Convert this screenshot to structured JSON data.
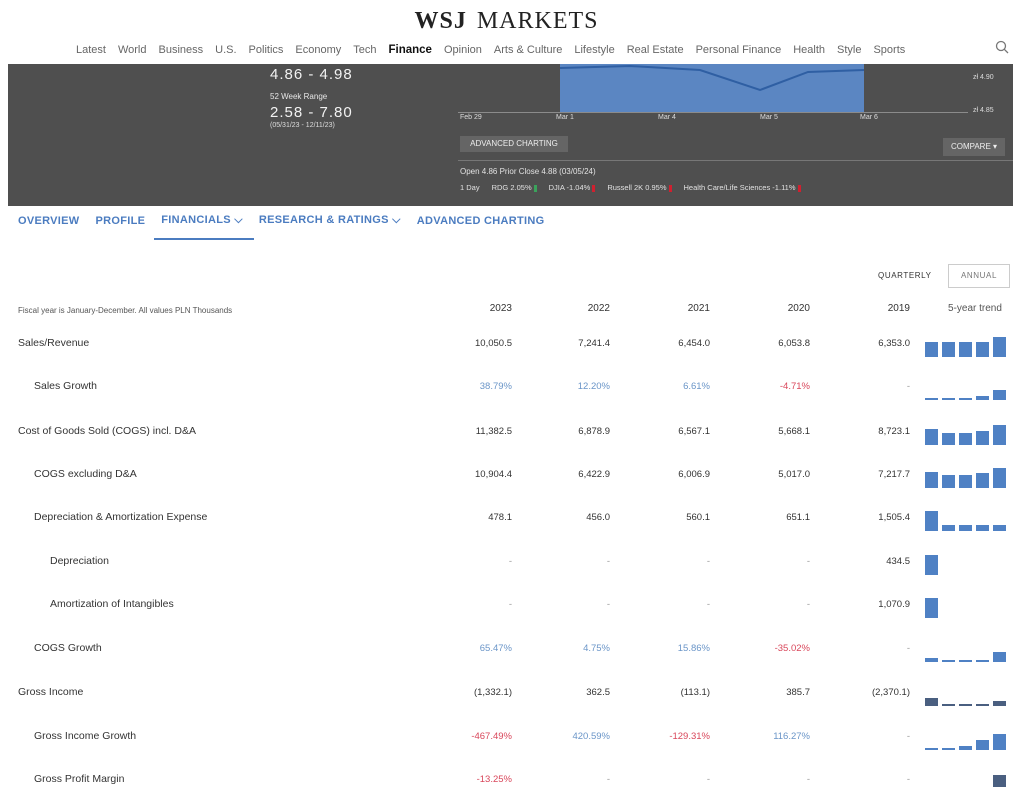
{
  "header": {
    "brand_wsj": "WSJ",
    "brand_markets": "MARKETS",
    "nav": [
      "Latest",
      "World",
      "Business",
      "U.S.",
      "Politics",
      "Economy",
      "Tech",
      "Finance",
      "Opinion",
      "Arts & Culture",
      "Lifestyle",
      "Real Estate",
      "Personal Finance",
      "Health",
      "Style",
      "Sports"
    ],
    "active_nav": "Finance"
  },
  "quote": {
    "day_range": "4.86 - 4.98",
    "week52_label": "52 Week Range",
    "week52_range": "2.58 - 7.80",
    "week52_dates": "(05/31/23 - 12/11/23)",
    "x_ticks": [
      "Feb 29",
      "Mar 1",
      "Mar 4",
      "Mar 5",
      "Mar 6"
    ],
    "y_ticks": [
      "zł 4.90",
      "zł 4.85"
    ],
    "advanced_charting_btn": "ADVANCED CHARTING",
    "compare_btn": "COMPARE",
    "open_line": "Open 4.86    Prior Close 4.88 (03/05/24)",
    "perf": [
      "1 Day",
      "RDG 2.05%",
      "DJIA -1.04%",
      "Russell 2K 0.95%",
      "Health Care/Life Sciences -1.11%"
    ]
  },
  "tabs": [
    "OVERVIEW",
    "PROFILE",
    "FINANCIALS",
    "RESEARCH & RATINGS",
    "ADVANCED CHARTING"
  ],
  "period_toggle": {
    "quarterly": "QUARTERLY",
    "annual": "ANNUAL"
  },
  "table": {
    "note": "Fiscal year is January-December. All values PLN Thousands",
    "years": [
      "2023",
      "2022",
      "2021",
      "2020",
      "2019"
    ],
    "trend_header": "5-year trend",
    "rows": [
      {
        "label": "Sales/Revenue",
        "indent": 0,
        "values": [
          "10,050.5",
          "7,241.4",
          "6,454.0",
          "6,053.8",
          "6,353.0"
        ],
        "style": "normal",
        "trend": [
          0.75,
          0.75,
          0.75,
          0.75,
          1.0
        ],
        "trend_color": "blue"
      },
      {
        "label": "Sales Growth",
        "indent": 1,
        "values": [
          "38.79%",
          "12.20%",
          "6.61%",
          "-4.71%",
          "-"
        ],
        "style": "growth",
        "styles": [
          "blue",
          "blue",
          "blue",
          "red",
          "gray"
        ],
        "trend": [
          0.05,
          0.1,
          0.1,
          0.2,
          0.5
        ],
        "trend_color": "blue"
      },
      {
        "label": "Cost of Goods Sold (COGS) incl. D&A",
        "indent": 0,
        "values": [
          "11,382.5",
          "6,878.9",
          "6,567.1",
          "5,668.1",
          "8,723.1"
        ],
        "style": "normal",
        "trend": [
          0.8,
          0.6,
          0.6,
          0.7,
          1.0
        ],
        "trend_color": "blue"
      },
      {
        "label": "COGS excluding D&A",
        "indent": 1,
        "values": [
          "10,904.4",
          "6,422.9",
          "6,006.9",
          "5,017.0",
          "7,217.7"
        ],
        "style": "normal",
        "trend": [
          0.8,
          0.65,
          0.65,
          0.75,
          1.0
        ],
        "trend_color": "blue"
      },
      {
        "label": "Depreciation & Amortization Expense",
        "indent": 1,
        "values": [
          "478.1",
          "456.0",
          "560.1",
          "651.1",
          "1,505.4"
        ],
        "style": "normal",
        "trend": [
          1.0,
          0.3,
          0.3,
          0.3,
          0.3
        ],
        "trend_color": "blue"
      },
      {
        "label": "Depreciation",
        "indent": 2,
        "values": [
          "-",
          "-",
          "-",
          "-",
          "434.5"
        ],
        "style": "normalgray",
        "trend": [
          1.0,
          0,
          0,
          0,
          0
        ],
        "trend_color": "blue"
      },
      {
        "label": "Amortization of Intangibles",
        "indent": 2,
        "values": [
          "-",
          "-",
          "-",
          "-",
          "1,070.9"
        ],
        "style": "normalgray",
        "trend": [
          1.0,
          0,
          0,
          0,
          0
        ],
        "trend_color": "blue"
      },
      {
        "label": "COGS Growth",
        "indent": 1,
        "values": [
          "65.47%",
          "4.75%",
          "15.86%",
          "-35.02%",
          "-"
        ],
        "style": "growth",
        "styles": [
          "blue",
          "blue",
          "blue",
          "red",
          "gray"
        ],
        "trend": [
          0.2,
          0.1,
          0.05,
          0.05,
          0.5
        ],
        "trend_color": "blue"
      },
      {
        "label": "Gross Income",
        "indent": 0,
        "values": [
          "(1,332.1)",
          "362.5",
          "(113.1)",
          "385.7",
          "(2,370.1)"
        ],
        "style": "normal",
        "trend": [
          0.4,
          0.1,
          0.1,
          0.1,
          0.25
        ],
        "trend_color": "dark"
      },
      {
        "label": "Gross Income Growth",
        "indent": 1,
        "values": [
          "-467.49%",
          "420.59%",
          "-129.31%",
          "116.27%",
          "-"
        ],
        "style": "growth",
        "styles": [
          "red",
          "blue",
          "red",
          "blue",
          "gray"
        ],
        "trend": [
          0.1,
          0.1,
          0.2,
          0.5,
          0.8
        ],
        "trend_color": "blue"
      },
      {
        "label": "Gross Profit Margin",
        "indent": 1,
        "values": [
          "-13.25%",
          "-",
          "-",
          "-",
          "-"
        ],
        "style": "growth",
        "styles": [
          "red",
          "gray",
          "gray",
          "gray",
          "gray"
        ],
        "trend": [
          0,
          0,
          0,
          0,
          0.9
        ],
        "trend_color": "dark"
      }
    ]
  }
}
